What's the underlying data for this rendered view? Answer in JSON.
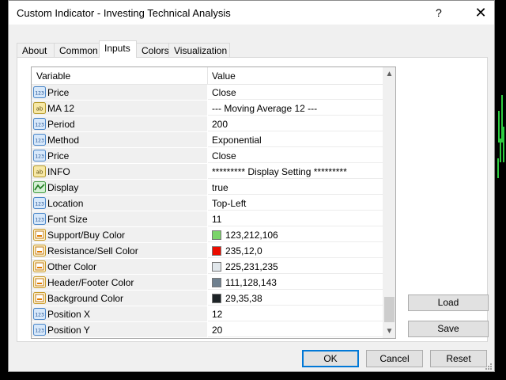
{
  "window": {
    "title": "Custom Indicator - Investing Technical Analysis",
    "help_glyph": "?",
    "close_glyph": "✕"
  },
  "tabs": [
    {
      "label": "About",
      "active": false
    },
    {
      "label": "Common",
      "active": false
    },
    {
      "label": "Inputs",
      "active": true
    },
    {
      "label": "Colors",
      "active": false
    },
    {
      "label": "Visualization",
      "active": false
    }
  ],
  "grid": {
    "columns": {
      "variable": "Variable",
      "value": "Value"
    },
    "rows": [
      {
        "icon": "number-icon",
        "name": "Price",
        "value": "Close"
      },
      {
        "icon": "text-icon",
        "name": "MA 12",
        "value": "--- Moving Average 12 ---"
      },
      {
        "icon": "number-icon",
        "name": "Period",
        "value": "200"
      },
      {
        "icon": "number-icon",
        "name": "Method",
        "value": "Exponential"
      },
      {
        "icon": "number-icon",
        "name": "Price",
        "value": "Close"
      },
      {
        "icon": "text-icon",
        "name": "INFO",
        "value": "********* Display Setting *********"
      },
      {
        "icon": "boolean-icon",
        "name": "Display",
        "value": "true"
      },
      {
        "icon": "number-icon",
        "name": "Location",
        "value": "Top-Left"
      },
      {
        "icon": "number-icon",
        "name": "Font Size",
        "value": "11"
      },
      {
        "icon": "color-icon",
        "name": "Support/Buy Color",
        "value": "123,212,106",
        "swatch": "#7bd46a"
      },
      {
        "icon": "color-icon",
        "name": "Resistance/Sell Color",
        "value": "235,12,0",
        "swatch": "#eb0c00"
      },
      {
        "icon": "color-icon",
        "name": "Other Color",
        "value": "225,231,235",
        "swatch": "#e1e7eb"
      },
      {
        "icon": "color-icon",
        "name": "Header/Footer Color",
        "value": "111,128,143",
        "swatch": "#6f808f"
      },
      {
        "icon": "color-icon",
        "name": "Background Color",
        "value": "29,35,38",
        "swatch": "#1d2326"
      },
      {
        "icon": "number-icon",
        "name": "Position X",
        "value": "12"
      },
      {
        "icon": "number-icon",
        "name": "Position Y",
        "value": "20"
      }
    ]
  },
  "side_buttons": {
    "load": "Load",
    "save": "Save"
  },
  "bottom_buttons": {
    "ok": "OK",
    "cancel": "Cancel",
    "reset": "Reset"
  },
  "colors": {
    "accent": "#0078d7",
    "chart_green": "#2ecc40"
  }
}
